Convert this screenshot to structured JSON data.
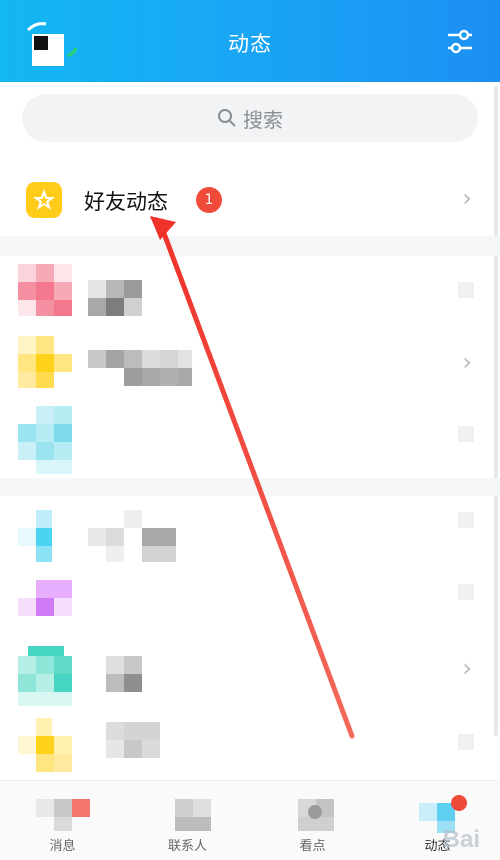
{
  "header": {
    "title": "动态",
    "bg_color": "#1aa3f5",
    "settings_icon": "sliders-icon"
  },
  "search": {
    "placeholder": "搜索",
    "icon": "search-icon"
  },
  "friend_feed": {
    "label": "好友动态",
    "badge_count": "1",
    "badge_color": "#f04b3a",
    "icon": "star-icon",
    "chevron": "›"
  },
  "list_items": [
    {
      "id": "item1",
      "has_chevron": false
    },
    {
      "id": "item2",
      "has_chevron": true
    },
    {
      "id": "item3",
      "has_chevron": false
    },
    {
      "id": "item4",
      "has_chevron": false
    },
    {
      "id": "item5",
      "has_chevron": false
    },
    {
      "id": "item6",
      "has_chevron": true
    },
    {
      "id": "item7",
      "has_chevron": false
    }
  ],
  "bottom_nav": {
    "items": [
      {
        "label": "消息",
        "icon": "messages-icon"
      },
      {
        "label": "联系人",
        "icon": "contacts-icon"
      },
      {
        "label": "看点",
        "icon": "watch-icon"
      },
      {
        "label": "动态",
        "icon": "feed-icon",
        "active": true
      }
    ]
  },
  "chevron_right": "›",
  "watermark": "Bai"
}
